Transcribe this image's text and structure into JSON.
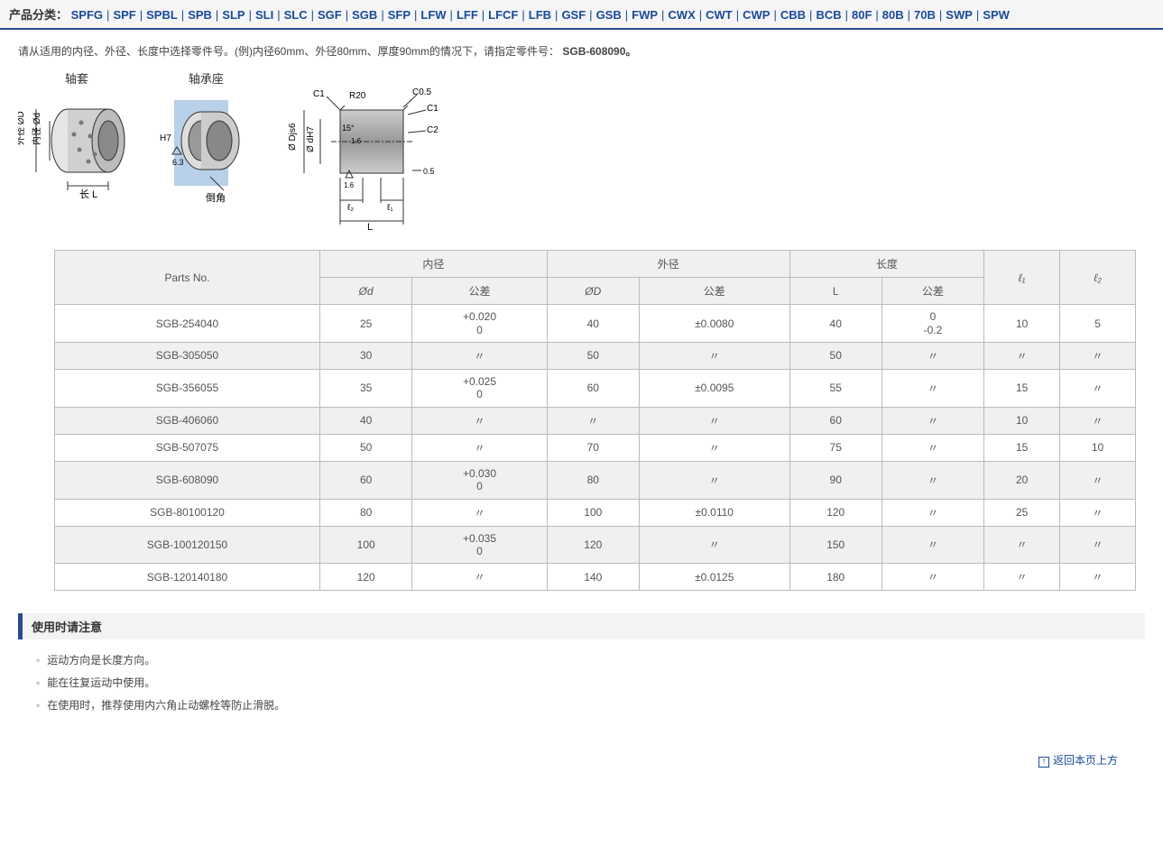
{
  "nav": {
    "label": "产品分类：",
    "items": [
      "SPFG",
      "SPF",
      "SPBL",
      "SPB",
      "SLP",
      "SLI",
      "SLC",
      "SGF",
      "SGB",
      "SFP",
      "LFW",
      "LFF",
      "LFCF",
      "LFB",
      "GSF",
      "GSB",
      "FWP",
      "CWX",
      "CWT",
      "CWP",
      "CBB",
      "BCB",
      "80F",
      "80B",
      "70B",
      "SWP",
      "SPW"
    ]
  },
  "intro": {
    "text_a": "请从适用的内径、外径、长度中选择零件号。(例)内径60mm、外径80mm、厚度90mm的情况下，请指定零件号：",
    "bold": "SGB-608090。"
  },
  "diagram": {
    "t1": "轴套",
    "t2": "轴承座",
    "labels": {
      "outer_d": "外径 ØD",
      "inner_d": "内径 Ød",
      "len": "长 L",
      "h7": "H7",
      "ra": "6.3",
      "chamfer_word": "倒角",
      "c1": "C1",
      "c05": "C0.5",
      "c2": "C2",
      "r20": "R20",
      "angle": "15°",
      "djs6": "Ø Djs6",
      "dh7": "Ø dH7",
      "small16": "1.6",
      "half": "0.5",
      "L": "L",
      "l1": "ℓ₁",
      "l2": "ℓ₂"
    }
  },
  "table": {
    "headers": {
      "parts": "Parts No.",
      "inner": "内径",
      "outer": "外径",
      "length": "长度",
      "d": "Ød",
      "D": "ØD",
      "L": "L",
      "tol": "公差",
      "l1": "ℓ₁",
      "l2": "ℓ₂"
    },
    "rows": [
      {
        "pn": "SGB-254040",
        "d": "25",
        "dt": "+0.020\n0",
        "D": "40",
        "Dt": "±0.0080",
        "L": "40",
        "Lt": "0\n-0.2",
        "l1": "10",
        "l2": "5"
      },
      {
        "pn": "SGB-305050",
        "d": "30",
        "dt": "〃",
        "D": "50",
        "Dt": "〃",
        "L": "50",
        "Lt": "〃",
        "l1": "〃",
        "l2": "〃"
      },
      {
        "pn": "SGB-356055",
        "d": "35",
        "dt": "+0.025\n0",
        "D": "60",
        "Dt": "±0.0095",
        "L": "55",
        "Lt": "〃",
        "l1": "15",
        "l2": "〃"
      },
      {
        "pn": "SGB-406060",
        "d": "40",
        "dt": "〃",
        "D": "〃",
        "Dt": "〃",
        "L": "60",
        "Lt": "〃",
        "l1": "10",
        "l2": "〃"
      },
      {
        "pn": "SGB-507075",
        "d": "50",
        "dt": "〃",
        "D": "70",
        "Dt": "〃",
        "L": "75",
        "Lt": "〃",
        "l1": "15",
        "l2": "10"
      },
      {
        "pn": "SGB-608090",
        "d": "60",
        "dt": "+0.030\n0",
        "D": "80",
        "Dt": "〃",
        "L": "90",
        "Lt": "〃",
        "l1": "20",
        "l2": "〃"
      },
      {
        "pn": "SGB-80100120",
        "d": "80",
        "dt": "〃",
        "D": "100",
        "Dt": "±0.0110",
        "L": "120",
        "Lt": "〃",
        "l1": "25",
        "l2": "〃"
      },
      {
        "pn": "SGB-100120150",
        "d": "100",
        "dt": "+0.035\n0",
        "D": "120",
        "Dt": "〃",
        "L": "150",
        "Lt": "〃",
        "l1": "〃",
        "l2": "〃"
      },
      {
        "pn": "SGB-120140180",
        "d": "120",
        "dt": "〃",
        "D": "140",
        "Dt": "±0.0125",
        "L": "180",
        "Lt": "〃",
        "l1": "〃",
        "l2": "〃"
      }
    ]
  },
  "notice": {
    "header": "使用时请注意",
    "items": [
      "运动方向是长度方向。",
      "能在往复运动中使用。",
      "在使用时，推荐使用内六角止动螺栓等防止滑脱。"
    ]
  },
  "back": {
    "label": "返回本页上方"
  }
}
